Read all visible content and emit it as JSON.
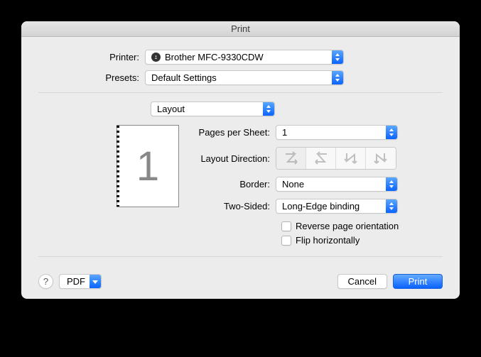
{
  "window": {
    "title": "Print"
  },
  "labels": {
    "printer": "Printer:",
    "presets": "Presets:",
    "pagesPerSheet": "Pages per Sheet:",
    "layoutDirection": "Layout Direction:",
    "border": "Border:",
    "twoSided": "Two-Sided:"
  },
  "values": {
    "printer": "Brother MFC-9330CDW",
    "presets": "Default Settings",
    "section": "Layout",
    "pagesPerSheet": "1",
    "border": "None",
    "twoSided": "Long-Edge binding",
    "previewNumber": "1"
  },
  "checkboxes": {
    "reverse": "Reverse page orientation",
    "flip": "Flip horizontally"
  },
  "footer": {
    "pdf": "PDF",
    "cancel": "Cancel",
    "print": "Print",
    "help": "?"
  }
}
